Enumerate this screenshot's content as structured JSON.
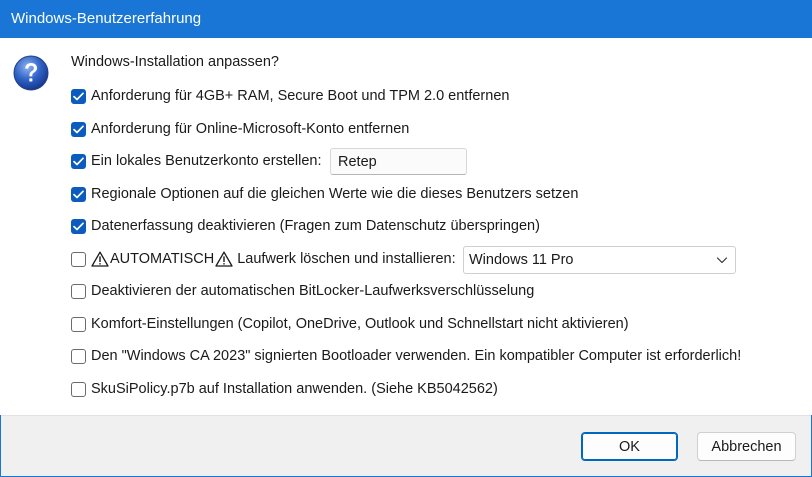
{
  "window": {
    "title": "Windows-Benutzererfahrung"
  },
  "prompt": "Windows-Installation anpassen?",
  "options": [
    {
      "label": "Anforderung für 4GB+ RAM, Secure Boot und TPM 2.0 entfernen",
      "checked": true
    },
    {
      "label": "Anforderung für Online-Microsoft-Konto entfernen",
      "checked": true
    },
    {
      "label": "Ein lokales Benutzerkonto erstellen:",
      "checked": true
    },
    {
      "label": "Regionale Optionen auf die gleichen Werte wie die dieses Benutzers setzen",
      "checked": true
    },
    {
      "label": "Datenerfassung deaktivieren (Fragen zum Datenschutz überspringen)",
      "checked": true
    },
    {
      "label_pre": "AUTOMATISCH",
      "label_post": "Laufwerk löschen und installieren:",
      "checked": false
    },
    {
      "label": "Deaktivieren der automatischen BitLocker-Laufwerksverschlüsselung",
      "checked": false
    },
    {
      "label": "Komfort-Einstellungen (Copilot, OneDrive, Outlook und Schnellstart nicht aktivieren)",
      "checked": false
    },
    {
      "label": "Den \"Windows CA 2023\" signierten Bootloader verwenden. Ein kompatibler Computer ist erforderlich!",
      "checked": false
    },
    {
      "label": "SkuSiPolicy.p7b auf Installation anwenden. (Siehe KB5042562)",
      "checked": false
    }
  ],
  "username_value": "Retep",
  "edition_select": {
    "selected": "Windows 11 Pro"
  },
  "buttons": {
    "ok": "OK",
    "cancel": "Abbrechen"
  },
  "colors": {
    "titlebar": "#1976d6",
    "checkbox_checked": "#0b5cbe",
    "default_button_border": "#0067c0",
    "footer": "#f0f0f0"
  },
  "icons": {
    "dialog": "question-icon",
    "warning": "warning-icon",
    "dropdown": "chevron-down-icon",
    "check": "checkmark-icon"
  }
}
